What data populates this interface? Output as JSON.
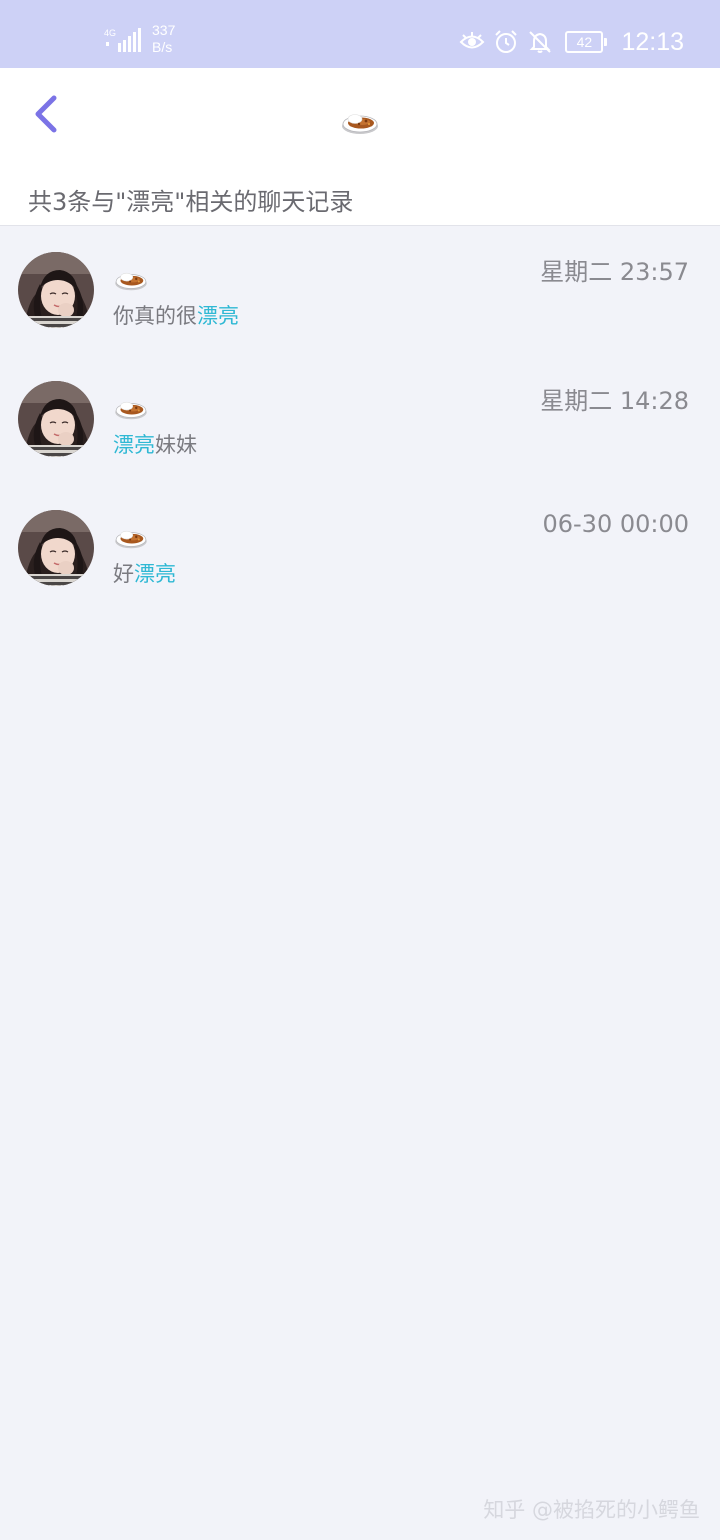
{
  "status_bar": {
    "network_type": "4G",
    "speed_value": "337",
    "speed_unit": "B/s",
    "battery": "42",
    "time": "12:13",
    "icons": [
      "signal-icon",
      "eye-icon",
      "alarm-icon",
      "bell-off-icon",
      "battery-icon"
    ]
  },
  "header": {
    "title_icon": "curry-rice-icon",
    "summary": "共3条与\"漂亮\"相关的聊天记录"
  },
  "results": [
    {
      "sender_icon": "curry-rice-icon",
      "time": "星期二 23:57",
      "msg_before": "你真的很",
      "msg_highlight": "漂亮",
      "msg_after": ""
    },
    {
      "sender_icon": "curry-rice-icon",
      "time": "星期二 14:28",
      "msg_before": "",
      "msg_highlight": "漂亮",
      "msg_after": "妹妹"
    },
    {
      "sender_icon": "curry-rice-icon",
      "time": "06-30 00:00",
      "msg_before": "好",
      "msg_highlight": "漂亮",
      "msg_after": ""
    }
  ],
  "watermark": "知乎 @被掐死的小鳄鱼",
  "colors": {
    "accent": "#7b73e6",
    "highlight": "#2fb8d4",
    "status_bar_bg": "#cdd1f6",
    "page_bg": "#f2f3f9"
  }
}
